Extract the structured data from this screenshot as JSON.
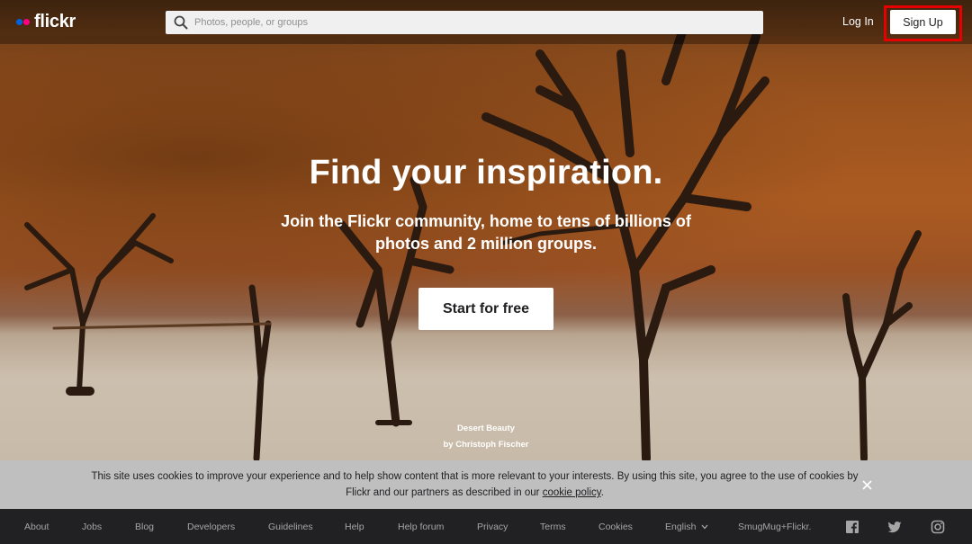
{
  "header": {
    "logo_text": "flickr",
    "search_placeholder": "Photos, people, or groups",
    "login_label": "Log In",
    "signup_label": "Sign Up"
  },
  "hero": {
    "headline": "Find your inspiration.",
    "subline": "Join the Flickr community, home to tens of billions of photos and 2 million groups.",
    "cta_label": "Start for free",
    "photo_title": "Desert Beauty",
    "photo_credit": "by Christoph Fischer"
  },
  "cookie_banner": {
    "text": "This site uses cookies to improve your experience and to help show content that is more relevant to your interests. By using this site, you agree to the use of cookies by Flickr and our partners as described in our ",
    "link_label": "cookie policy",
    "text_end": "."
  },
  "footer": {
    "links": [
      "About",
      "Jobs",
      "Blog",
      "Developers",
      "Guidelines",
      "Help",
      "Help forum",
      "Privacy",
      "Terms",
      "Cookies",
      "English",
      "SmugMug+Flickr."
    ],
    "social_icons": [
      "facebook-icon",
      "twitter-icon",
      "instagram-icon"
    ]
  },
  "colors": {
    "brand_blue": "#0063dc",
    "brand_pink": "#ff0084",
    "highlight_red": "#e60000",
    "footer_bg": "#212124"
  }
}
